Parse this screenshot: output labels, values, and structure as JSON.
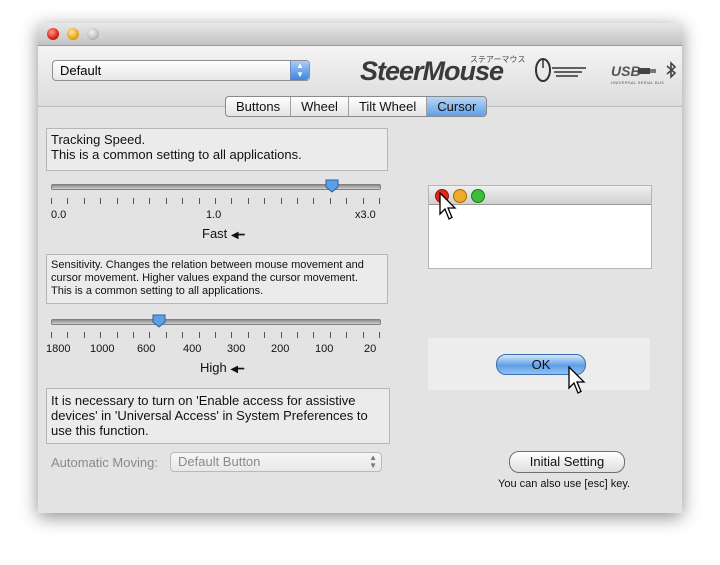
{
  "header": {
    "preset_popup_value": "Default",
    "logo_text": "SteerMouse",
    "logo_kana": "ステアーマウス",
    "usb_label": "USB",
    "usb_sub": "UNIVERSAL SERIAL BUS"
  },
  "tabs": [
    {
      "label": "Buttons",
      "selected": false
    },
    {
      "label": "Wheel",
      "selected": false
    },
    {
      "label": "Tilt Wheel",
      "selected": false
    },
    {
      "label": "Cursor",
      "selected": true
    }
  ],
  "tracking": {
    "desc_line1": "Tracking Speed.",
    "desc_line2": "This is a common setting to all applications.",
    "scale_min": "0.0",
    "scale_mid": "1.0",
    "scale_max": "x3.0",
    "caption": "Fast",
    "value_fraction": 0.85
  },
  "sensitivity": {
    "desc_line1": "Sensitivity. Changes the relation between mouse movement and",
    "desc_line2": "cursor movement. Higher values expand the cursor movement.",
    "desc_line3": "This is a common setting to all applications.",
    "scale_labels": [
      "1800",
      "1000",
      "600",
      "400",
      "300",
      "200",
      "100",
      "20"
    ],
    "caption": "High",
    "value": 600
  },
  "assistive_note": {
    "line1": "It is necessary to turn on 'Enable access for assistive",
    "line2": "devices' in 'Universal Access' in System Preferences to",
    "line3": "use this function."
  },
  "automatic_moving": {
    "label": "Automatic Moving:",
    "value": "Default Button"
  },
  "preview": {
    "ok_label": "OK"
  },
  "initial_setting": {
    "button_label": "Initial Setting",
    "note": "You can also use [esc] key."
  }
}
